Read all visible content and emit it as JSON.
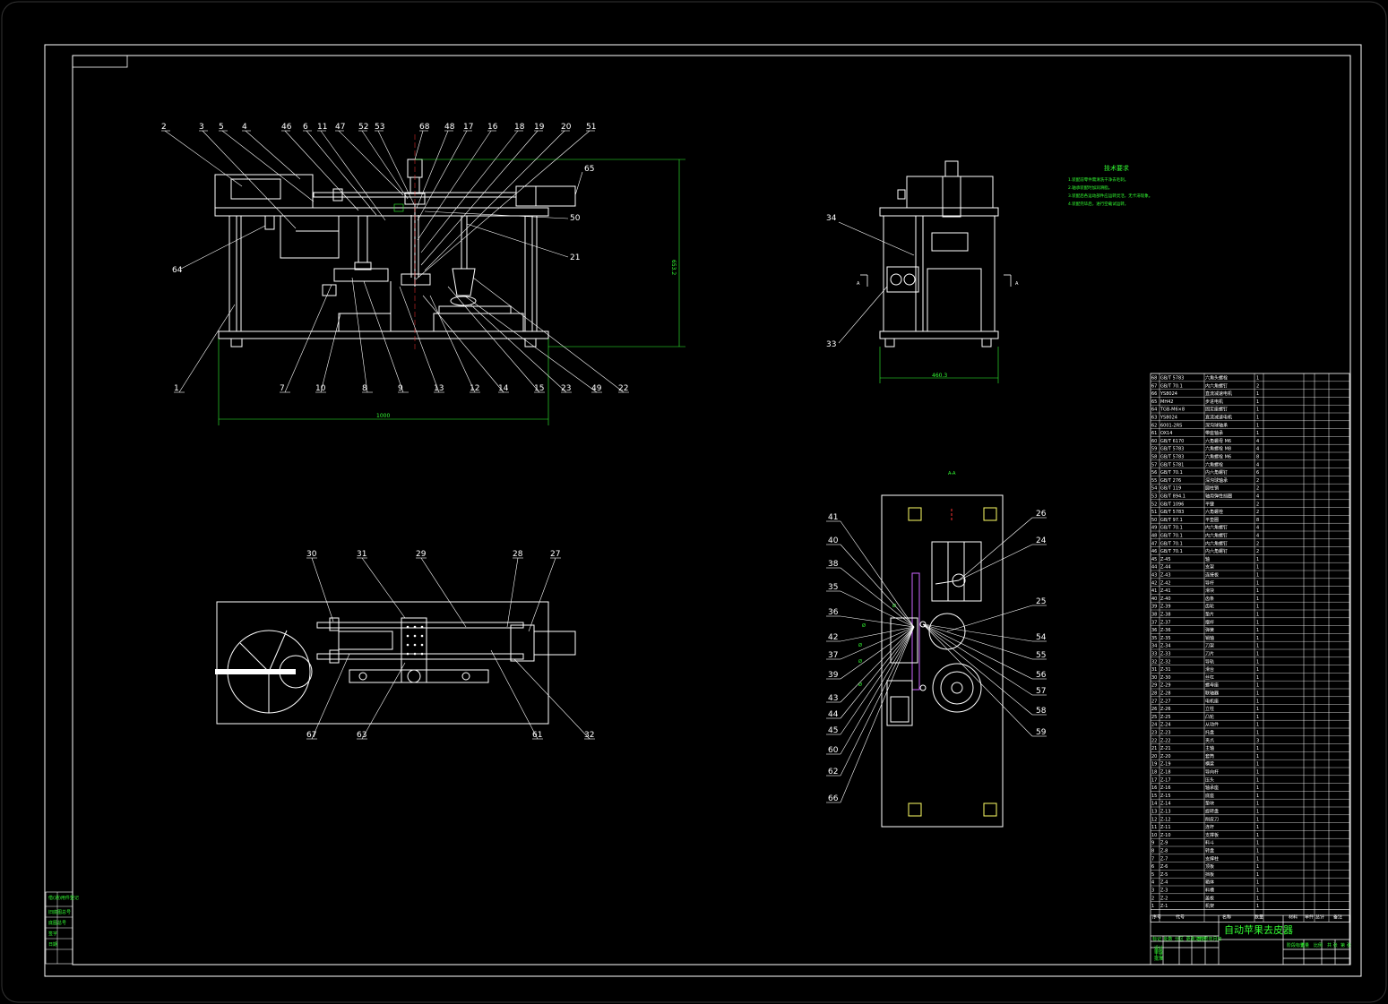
{
  "drawing": {
    "title": "自动苹果去皮器",
    "tech_requirements_title": "技术要求",
    "tech_requirements": [
      "1.装配前零件需清洗干净去毛刺。",
      "2.轴承装配时加润滑脂。",
      "3.装配后各运动部件应运转灵活，无卡滞现象。",
      "4.装配完毕后，进行空载试运转。"
    ],
    "section_label": "A-A",
    "section_marks": [
      "A",
      "A"
    ],
    "colors": {
      "background": "#000000",
      "line": "#ffffff",
      "accent": "#33ff33",
      "dim": "#33ff33",
      "hidden": "#ff3333"
    }
  },
  "front_view": {
    "top_labels": [
      "2",
      "3",
      "5",
      "4",
      "46",
      "6",
      "11",
      "47",
      "52",
      "53",
      "68",
      "48",
      "17",
      "16",
      "18",
      "19",
      "20",
      "51"
    ],
    "bottom_labels": [
      "1",
      "7",
      "10",
      "8",
      "9",
      "13",
      "12",
      "14",
      "15",
      "23",
      "49",
      "22"
    ],
    "side_labels": {
      "left": "64",
      "right_top": "65",
      "right_mid": "50",
      "right_mid2": "21"
    },
    "dim_width": "1000",
    "dim_height": "653.2"
  },
  "side_view": {
    "labels": [
      "34",
      "33"
    ],
    "dim_width": "460.3"
  },
  "top_view": {
    "top_labels": [
      "30",
      "31",
      "29",
      "28",
      "27"
    ],
    "bottom_labels": [
      "67",
      "63",
      "61",
      "32"
    ]
  },
  "section_view": {
    "left_labels": [
      "41",
      "40",
      "38",
      "35",
      "36",
      "42",
      "37",
      "39",
      "43",
      "44",
      "45",
      "60",
      "62",
      "66"
    ],
    "right_labels": [
      "26",
      "24",
      "25",
      "54",
      "55",
      "56",
      "57",
      "58",
      "59"
    ]
  },
  "parts_table": {
    "header": [
      "序号",
      "代号",
      "名称",
      "数量",
      "材料",
      "单件",
      "总计",
      "备注"
    ],
    "rows": [
      [
        "68",
        "GB/T 5783",
        "六角头螺栓",
        "1",
        "",
        "",
        "",
        ""
      ],
      [
        "67",
        "GB/T 70.1",
        "内六角螺钉",
        "2",
        "",
        "",
        "",
        ""
      ],
      [
        "66",
        "YS8024",
        "直流减速电机",
        "1",
        "",
        "",
        "",
        ""
      ],
      [
        "65",
        "MH42",
        "步进电机",
        "1",
        "",
        "",
        "",
        ""
      ],
      [
        "64",
        "TGB-M6×8",
        "固定座螺钉",
        "1",
        "",
        "",
        "",
        ""
      ],
      [
        "63",
        "YS8024",
        "直流减速电机",
        "1",
        "",
        "",
        "",
        ""
      ],
      [
        "62",
        "6001-2RS",
        "深沟球轴承",
        "1",
        "",
        "",
        "",
        ""
      ],
      [
        "61",
        "OX14",
        "带座轴承",
        "1",
        "",
        "",
        "",
        ""
      ],
      [
        "60",
        "GB/T 6170",
        "六角螺母 M6",
        "4",
        "",
        "",
        "",
        ""
      ],
      [
        "59",
        "GB/T 5783",
        "六角螺栓 M8",
        "4",
        "",
        "",
        "",
        ""
      ],
      [
        "58",
        "GB/T 5783",
        "六角螺栓 M6",
        "8",
        "",
        "",
        "",
        ""
      ],
      [
        "57",
        "GB/T 5781",
        "六角螺栓",
        "4",
        "",
        "",
        "",
        ""
      ],
      [
        "56",
        "GB/T 70.1",
        "内六角螺钉",
        "6",
        "",
        "",
        "",
        ""
      ],
      [
        "55",
        "GB/T 276",
        "深沟球轴承",
        "2",
        "",
        "",
        "",
        ""
      ],
      [
        "54",
        "GB/T 119",
        "圆柱销",
        "2",
        "",
        "",
        "",
        ""
      ],
      [
        "53",
        "GB/T 894.1",
        "轴用弹性挡圈",
        "4",
        "",
        "",
        "",
        ""
      ],
      [
        "52",
        "GB/T 1096",
        "平键",
        "2",
        "",
        "",
        "",
        ""
      ],
      [
        "51",
        "GB/T 5783",
        "六角螺栓",
        "2",
        "",
        "",
        "",
        ""
      ],
      [
        "50",
        "GB/T 97.1",
        "平垫圈",
        "8",
        "",
        "",
        "",
        ""
      ],
      [
        "49",
        "GB/T 70.1",
        "内六角螺钉",
        "4",
        "",
        "",
        "",
        ""
      ],
      [
        "48",
        "GB/T 70.1",
        "内六角螺钉",
        "4",
        "",
        "",
        "",
        ""
      ],
      [
        "47",
        "GB/T 70.1",
        "内六角螺钉",
        "2",
        "",
        "",
        "",
        ""
      ],
      [
        "46",
        "GB/T 70.1",
        "内六角螺钉",
        "2",
        "",
        "",
        "",
        ""
      ],
      [
        "45",
        "Z-45",
        "轴",
        "1",
        "",
        "",
        "",
        ""
      ],
      [
        "44",
        "Z-44",
        "支架",
        "1",
        "",
        "",
        "",
        ""
      ],
      [
        "43",
        "Z-43",
        "连接板",
        "1",
        "",
        "",
        "",
        ""
      ],
      [
        "42",
        "Z-42",
        "导杆",
        "1",
        "",
        "",
        "",
        ""
      ],
      [
        "41",
        "Z-41",
        "滑块",
        "1",
        "",
        "",
        "",
        ""
      ],
      [
        "40",
        "Z-40",
        "齿条",
        "1",
        "",
        "",
        "",
        ""
      ],
      [
        "39",
        "Z-39",
        "齿轮",
        "1",
        "",
        "",
        "",
        ""
      ],
      [
        "38",
        "Z-38",
        "垫片",
        "1",
        "",
        "",
        "",
        ""
      ],
      [
        "37",
        "Z-37",
        "摆杆",
        "1",
        "",
        "",
        "",
        ""
      ],
      [
        "36",
        "Z-36",
        "弹簧",
        "1",
        "",
        "",
        "",
        ""
      ],
      [
        "35",
        "Z-35",
        "销轴",
        "1",
        "",
        "",
        "",
        ""
      ],
      [
        "34",
        "Z-34",
        "刀架",
        "1",
        "",
        "",
        "",
        ""
      ],
      [
        "33",
        "Z-33",
        "刀片",
        "1",
        "",
        "",
        "",
        ""
      ],
      [
        "32",
        "Z-32",
        "导轨",
        "1",
        "",
        "",
        "",
        ""
      ],
      [
        "31",
        "Z-31",
        "滑台",
        "1",
        "",
        "",
        "",
        ""
      ],
      [
        "30",
        "Z-30",
        "丝杠",
        "1",
        "",
        "",
        "",
        ""
      ],
      [
        "29",
        "Z-29",
        "螺母座",
        "1",
        "",
        "",
        "",
        ""
      ],
      [
        "28",
        "Z-28",
        "联轴器",
        "1",
        "",
        "",
        "",
        ""
      ],
      [
        "27",
        "Z-27",
        "电机座",
        "1",
        "",
        "",
        "",
        ""
      ],
      [
        "26",
        "Z-26",
        "立柱",
        "1",
        "",
        "",
        "",
        ""
      ],
      [
        "25",
        "Z-25",
        "凸轮",
        "1",
        "",
        "",
        "",
        ""
      ],
      [
        "24",
        "Z-24",
        "从动件",
        "1",
        "",
        "",
        "",
        ""
      ],
      [
        "23",
        "Z-23",
        "托盘",
        "1",
        "",
        "",
        "",
        ""
      ],
      [
        "22",
        "Z-22",
        "夹爪",
        "3",
        "",
        "",
        "",
        ""
      ],
      [
        "21",
        "Z-21",
        "主轴",
        "1",
        "",
        "",
        "",
        ""
      ],
      [
        "20",
        "Z-20",
        "套筒",
        "1",
        "",
        "",
        "",
        ""
      ],
      [
        "19",
        "Z-19",
        "横梁",
        "1",
        "",
        "",
        "",
        ""
      ],
      [
        "18",
        "Z-18",
        "导向杆",
        "1",
        "",
        "",
        "",
        ""
      ],
      [
        "17",
        "Z-17",
        "压头",
        "1",
        "",
        "",
        "",
        ""
      ],
      [
        "16",
        "Z-16",
        "轴承座",
        "1",
        "",
        "",
        "",
        ""
      ],
      [
        "15",
        "Z-15",
        "底座",
        "1",
        "",
        "",
        "",
        ""
      ],
      [
        "14",
        "Z-14",
        "垫块",
        "1",
        "",
        "",
        "",
        ""
      ],
      [
        "13",
        "Z-13",
        "旋转盘",
        "1",
        "",
        "",
        "",
        ""
      ],
      [
        "12",
        "Z-12",
        "削皮刀",
        "1",
        "",
        "",
        "",
        ""
      ],
      [
        "11",
        "Z-11",
        "连杆",
        "1",
        "",
        "",
        "",
        ""
      ],
      [
        "10",
        "Z-10",
        "支撑板",
        "1",
        "",
        "",
        "",
        ""
      ],
      [
        "9",
        "Z-9",
        "料斗",
        "1",
        "",
        "",
        "",
        ""
      ],
      [
        "8",
        "Z-8",
        "转盘",
        "1",
        "",
        "",
        "",
        ""
      ],
      [
        "7",
        "Z-7",
        "支撑柱",
        "1",
        "",
        "",
        "",
        ""
      ],
      [
        "6",
        "Z-6",
        "顶板",
        "1",
        "",
        "",
        "",
        ""
      ],
      [
        "5",
        "Z-5",
        "挡板",
        "1",
        "",
        "",
        "",
        ""
      ],
      [
        "4",
        "Z-4",
        "箱体",
        "1",
        "",
        "",
        "",
        ""
      ],
      [
        "3",
        "Z-3",
        "料槽",
        "1",
        "",
        "",
        "",
        ""
      ],
      [
        "2",
        "Z-2",
        "盖板",
        "1",
        "",
        "",
        "",
        ""
      ],
      [
        "1",
        "Z-1",
        "机架",
        "1",
        "",
        "",
        "",
        ""
      ]
    ]
  },
  "title_block": {
    "left_cells": [
      "标记",
      "处数",
      "分区",
      "更改文件号",
      "签名",
      "年月日"
    ],
    "sign_cells": [
      "设计",
      "审核",
      "工艺",
      "批准"
    ],
    "right_cells": [
      "阶段标记",
      "重量",
      "比例",
      "共 张",
      "第 张"
    ]
  },
  "margin_stamp": [
    "借(通)用件登记",
    "旧底图总号",
    "底图总号",
    "签字",
    "日期"
  ]
}
